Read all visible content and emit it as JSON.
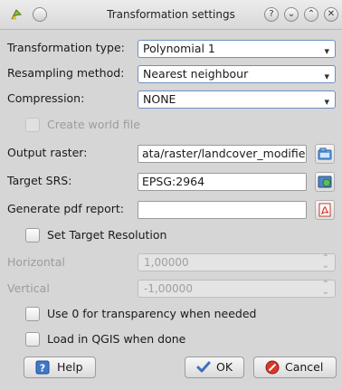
{
  "window": {
    "title": "Transformation settings",
    "controls": [
      "help",
      "minimize",
      "maximize",
      "close"
    ]
  },
  "form": {
    "transformation_type": {
      "label": "Transformation type:",
      "value": "Polynomial 1"
    },
    "resampling_method": {
      "label": "Resampling method:",
      "value": "Nearest neighbour"
    },
    "compression": {
      "label": "Compression:",
      "value": "NONE"
    },
    "create_world_file": {
      "label": "Create world file",
      "checked": false,
      "enabled": false
    },
    "output_raster": {
      "label": "Output raster:",
      "value": "ata/raster/landcover_modified.tif"
    },
    "target_srs": {
      "label": "Target SRS:",
      "value": "EPSG:2964"
    },
    "pdf_report": {
      "label": "Generate pdf report:",
      "value": ""
    },
    "set_target_resolution": {
      "label": "Set Target Resolution",
      "checked": false
    },
    "horizontal": {
      "label": "Horizontal",
      "value": "1,00000"
    },
    "vertical": {
      "label": "Vertical",
      "value": "-1,00000"
    },
    "use_zero_transparency": {
      "label": "Use 0 for transparency when needed",
      "checked": false
    },
    "load_in_qgis": {
      "label": "Load in QGIS when done",
      "checked": false
    }
  },
  "buttons": {
    "help": "Help",
    "ok": "OK",
    "cancel": "Cancel"
  },
  "colors": {
    "window_bg": "#d6d6d6",
    "combo_border": "#6f8fbf",
    "cancel_icon": "#d9362b",
    "ok_check": "#3f6fbf"
  }
}
